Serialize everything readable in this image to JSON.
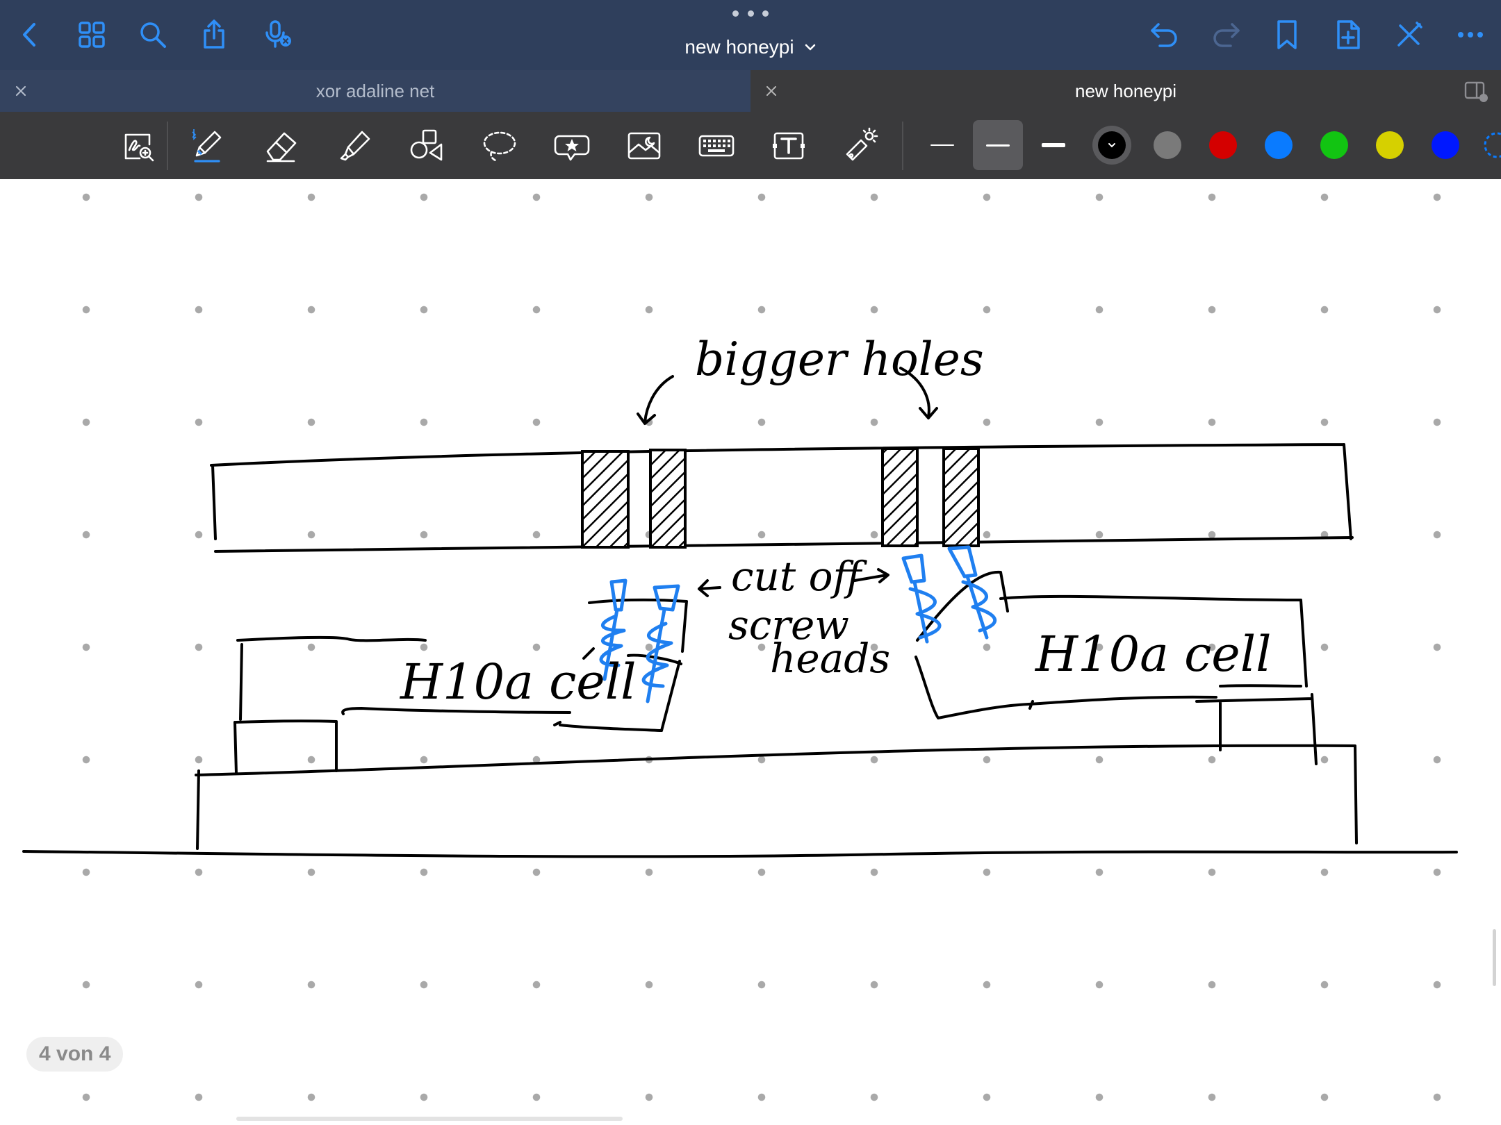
{
  "navbar": {
    "title": "new honeypi",
    "icons": [
      "back-icon",
      "grid-icon",
      "search-icon",
      "share-icon",
      "microphone-icon",
      "undo-icon",
      "redo-icon",
      "bookmark-icon",
      "add-page-icon",
      "close-edit-icon",
      "more-icon"
    ]
  },
  "tabs": [
    {
      "label": "xor adaline net",
      "active": false
    },
    {
      "label": "new honeypi",
      "active": true
    }
  ],
  "toolbar": {
    "tools": [
      "zoom-window",
      "pen",
      "eraser",
      "highlighter",
      "shapes",
      "lasso",
      "elements",
      "image",
      "keyboard",
      "text-box",
      "laser-pointer"
    ],
    "selected_tool": "pen",
    "stroke_widths": [
      "thin",
      "medium",
      "thick"
    ],
    "selected_stroke": "medium",
    "colors": [
      "#000000",
      "#7a7a7a",
      "#d40000",
      "#0a7bff",
      "#12c412",
      "#d6d000",
      "#0018ff"
    ],
    "selected_color": "#000000"
  },
  "sketch": {
    "label_top": "bigger holes",
    "label_middle_1": "cut off",
    "label_middle_2": "screw",
    "label_middle_3": "heads",
    "label_left_cell": "H10a cell",
    "label_right_cell": "H10a cell",
    "ink_color": "#000000",
    "screw_color": "#1f7ff0"
  },
  "page_indicator": "4 von 4"
}
